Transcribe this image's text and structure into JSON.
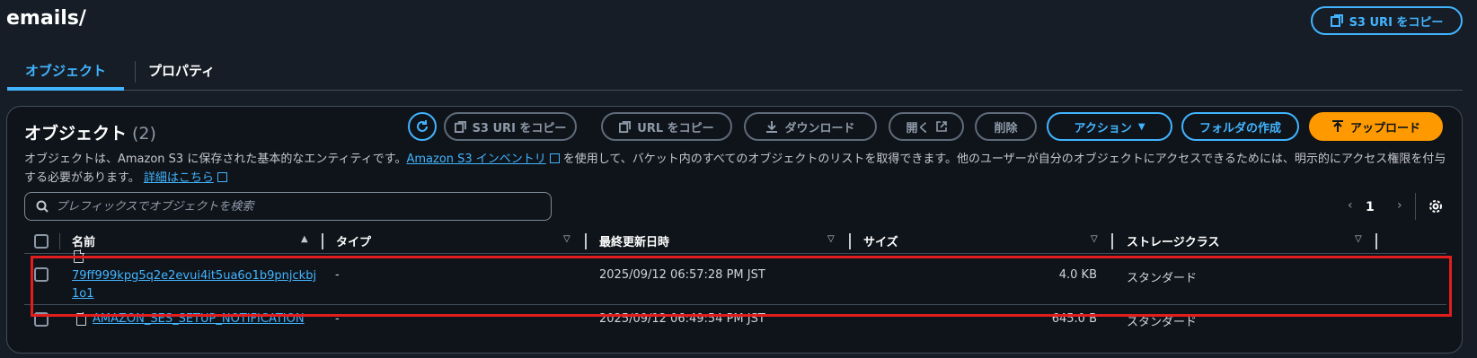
{
  "header": {
    "title": "emails/",
    "copy_uri_label": "S3 URI をコピー"
  },
  "tabs": [
    {
      "label": "オブジェクト",
      "active": true
    },
    {
      "label": "プロパティ",
      "active": false
    }
  ],
  "panel": {
    "title": "オブジェクト",
    "count": "(2)",
    "actions": {
      "copy_s3_uri": "S3 URI をコピー",
      "copy_url": "URL をコピー",
      "download": "ダウンロード",
      "open": "開く",
      "delete": "削除",
      "actions_menu": "アクション",
      "create_folder": "フォルダの作成",
      "upload": "アップロード"
    },
    "description": {
      "part1": "オブジェクトは、Amazon S3 に保存された基本的なエンティティです。",
      "link1": "Amazon S3 インベントリ",
      "part2": "を使用して、バケット内のすべてのオブジェクトのリストを取得できます。他のユーザーが自分のオブジェクトにアクセスできるためには、明示的にアクセス権限を付与する必要があります。",
      "link2": "詳細はこちら"
    },
    "search": {
      "placeholder": "プレフィックスでオブジェクトを検索"
    },
    "pagination": {
      "page": "1"
    },
    "columns": {
      "name": "名前",
      "type": "タイプ",
      "modified": "最終更新日時",
      "size": "サイズ",
      "storage": "ストレージクラス"
    },
    "rows": [
      {
        "name": "79ff999kpg5q2e2evui4it5ua6o1b9pnjckbj1o1",
        "name_line1": "79ff999kpg5q2e2evui4it5ua6o1b9pnjckbj",
        "name_line2": "1o1",
        "type": "-",
        "modified": "2025/09/12 06:57:28 PM JST",
        "size": "4.0 KB",
        "storage": "スタンダード"
      },
      {
        "name": "AMAZON_SES_SETUP_NOTIFICATION",
        "type": "-",
        "modified": "2025/09/12 06:49:54 PM JST",
        "size": "645.0 B",
        "storage": "スタンダード"
      }
    ]
  },
  "colors": {
    "accent": "#42b4ff",
    "primary": "#ff9900",
    "highlight": "#e21d1d"
  }
}
